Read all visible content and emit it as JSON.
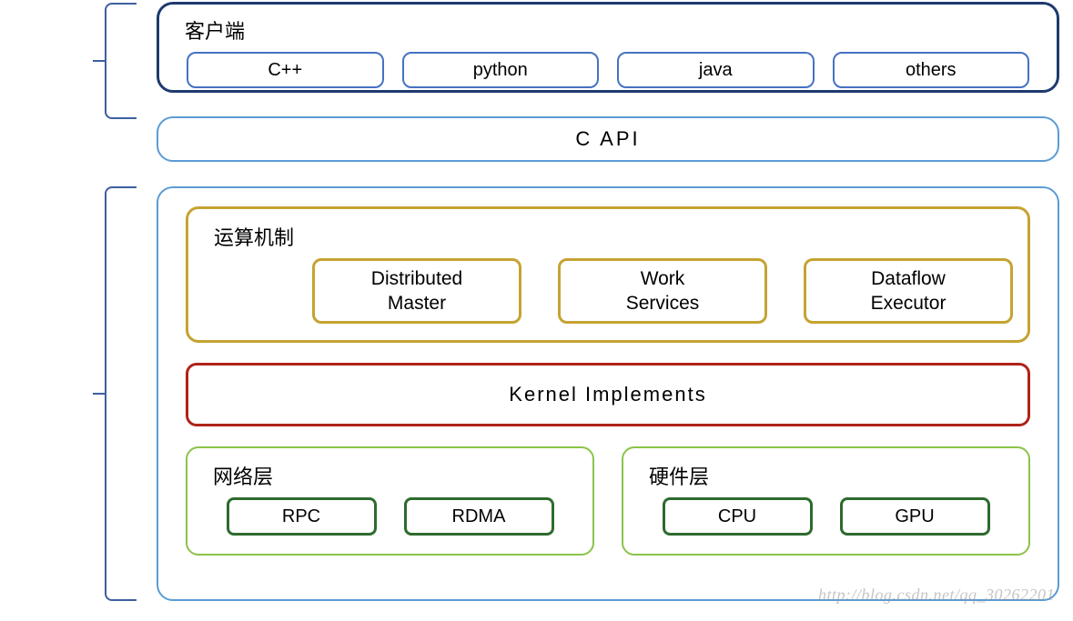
{
  "client": {
    "title": "客户端",
    "langs": [
      "C++",
      "python",
      "java",
      "others"
    ]
  },
  "api": {
    "label": "C  API"
  },
  "compute": {
    "title": "运算机制",
    "boxes": [
      "Distributed\nMaster",
      "Work\nServices",
      "Dataflow\nExecutor"
    ]
  },
  "kernel": {
    "label": "Kernel   Implements"
  },
  "network": {
    "title": "网络层",
    "items": [
      "RPC",
      "RDMA"
    ]
  },
  "hardware": {
    "title": "硬件层",
    "items": [
      "CPU",
      "GPU"
    ]
  },
  "watermark": "http://blog.csdn.net/qq_30262201"
}
